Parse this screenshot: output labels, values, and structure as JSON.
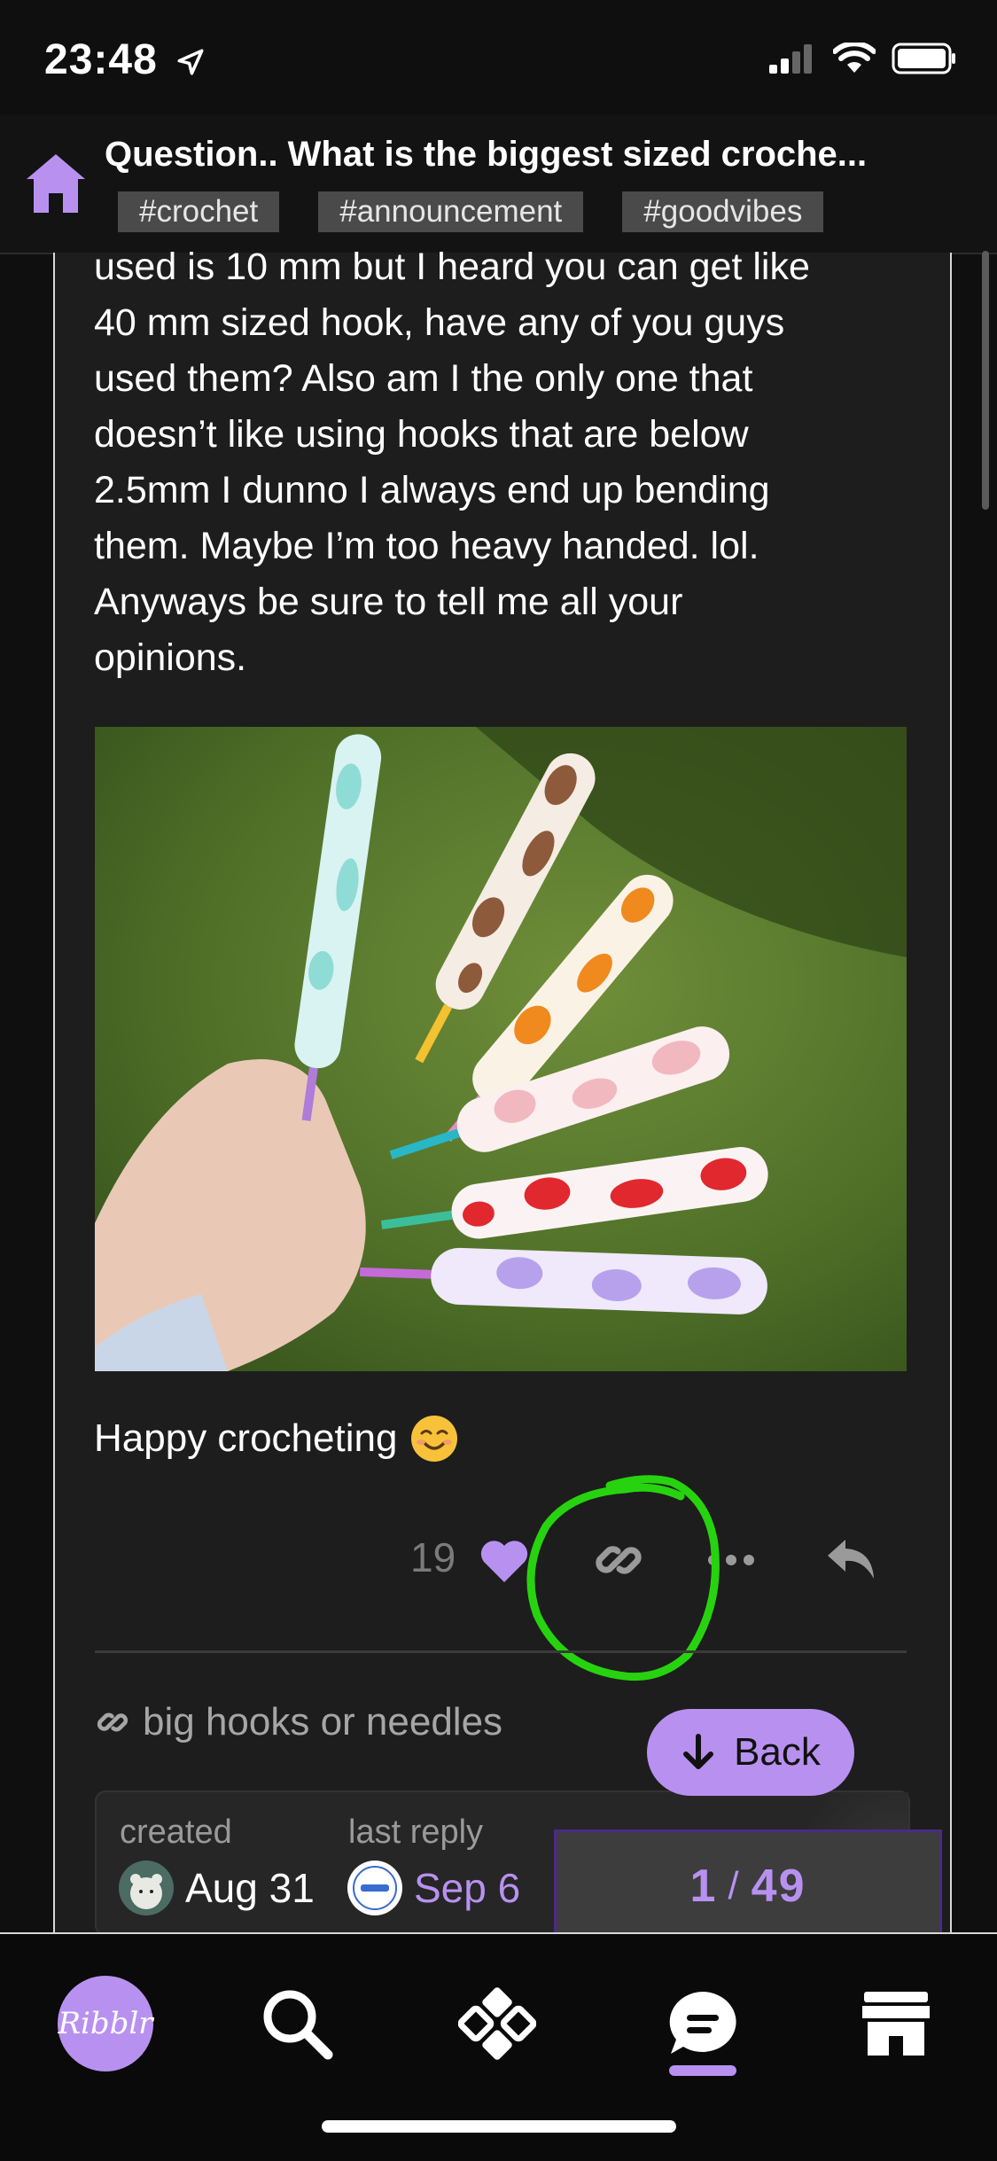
{
  "status_bar": {
    "time": "23:48"
  },
  "header": {
    "title": "Question.. What is the biggest sized croche...",
    "tags": [
      "#crochet",
      "#announcement",
      "#goodvibes"
    ]
  },
  "post": {
    "text_lines": [
      "used is 10 mm but I heard you can get like",
      "40 mm sized hook, have any of you guys",
      "used them? Also am I the only one that",
      "doesn’t like using hooks that are below",
      "2.5mm I dunno I always end up bending",
      "them. Maybe I’m too heavy handed. lol.",
      "Anyways be sure to tell me all your",
      "opinions."
    ],
    "closing": "Happy crocheting",
    "likes": "19"
  },
  "linked_topic": "big hooks or needles",
  "back_button": "Back",
  "topic_map": {
    "created_label": "created",
    "created_date": "Aug 31",
    "last_reply_label": "last reply",
    "last_reply_date": "Sep 6"
  },
  "progress": {
    "current": "1",
    "total": "49"
  },
  "bottom_nav": {
    "logo_text": "Ribblr"
  },
  "colors": {
    "accent": "#b891f0",
    "annotation": "#27d30f"
  }
}
